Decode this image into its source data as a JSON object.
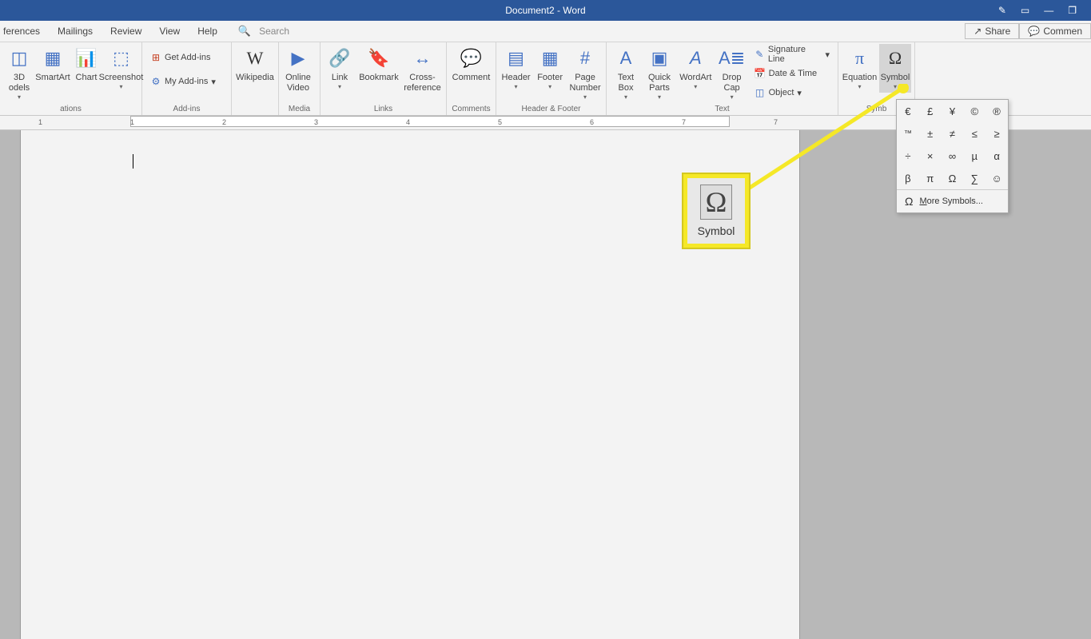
{
  "window": {
    "title": "Document2 - Word"
  },
  "titlebar_icons": {
    "pen": "✎",
    "box": "▭",
    "min": "—",
    "restore": "❐"
  },
  "tabs": [
    "ferences",
    "Mailings",
    "Review",
    "View",
    "Help"
  ],
  "search": {
    "placeholder": "Search"
  },
  "share": {
    "share_label": "Share",
    "comment_label": "Commen"
  },
  "ribbon": {
    "illustrations": {
      "group_label": "ations",
      "models": "3D\nodels",
      "smartart": "SmartArt",
      "chart": "Chart",
      "screenshot": "Screenshot"
    },
    "addins": {
      "group_label": "Add-ins",
      "get": "Get Add-ins",
      "my": "My Add-ins"
    },
    "wiki": {
      "label": "Wikipedia"
    },
    "media": {
      "group_label": "Media",
      "video": "Online\nVideo"
    },
    "links": {
      "group_label": "Links",
      "link": "Link",
      "bookmark": "Bookmark",
      "crossref": "Cross-\nreference"
    },
    "comments": {
      "group_label": "Comments",
      "comment": "Comment"
    },
    "headerfooter": {
      "group_label": "Header & Footer",
      "header": "Header",
      "footer": "Footer",
      "pagenum": "Page\nNumber"
    },
    "text": {
      "group_label": "Text",
      "textbox": "Text\nBox",
      "quickparts": "Quick\nParts",
      "wordart": "WordArt",
      "dropcap": "Drop\nCap",
      "sigline": "Signature Line",
      "datetime": "Date & Time",
      "object": "Object"
    },
    "symbols": {
      "group_label": "Symb",
      "equation": "Equation",
      "symbol": "Symbol"
    }
  },
  "ruler_marks": [
    "1",
    "2",
    "3",
    "4",
    "5",
    "6",
    "7"
  ],
  "symbol_dropdown": {
    "grid": [
      "€",
      "£",
      "¥",
      "©",
      "®",
      "™",
      "±",
      "≠",
      "≤",
      "≥",
      "÷",
      "×",
      "∞",
      "µ",
      "α",
      "β",
      "π",
      "Ω",
      "∑",
      "☺"
    ],
    "more_label": "ore Symbols...",
    "more_prefix": "M",
    "omega": "Ω"
  },
  "callout": {
    "icon": "Ω",
    "label": "Symbol"
  }
}
